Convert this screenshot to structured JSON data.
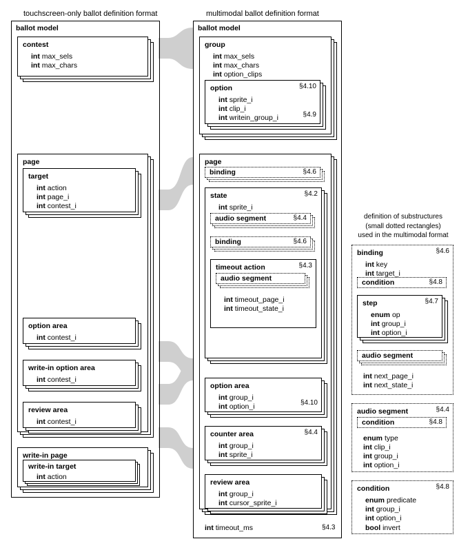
{
  "titles": {
    "left": "touchscreen-only ballot definition format",
    "mid": "multimodal ballot definition format",
    "sidenote1": "definition of substructures",
    "sidenote2": "(small dotted rectangles)",
    "sidenote3": "used in the multimodal format"
  },
  "labels": {
    "ballot_model": "ballot model",
    "contest": "contest",
    "group": "group",
    "option": "option",
    "page": "page",
    "target": "target",
    "binding": "binding",
    "state": "state",
    "audio_segment": "audio segment",
    "timeout_action": "timeout action",
    "option_area": "option area",
    "write_in_option_area": "write-in option area",
    "review_area": "review area",
    "counter_area": "counter area",
    "write_in_page": "write-in page",
    "write_in_target": "write-in target",
    "condition": "condition",
    "step": "step"
  },
  "types": {
    "int": "int",
    "enum": "enum",
    "bool": "bool"
  },
  "fields": {
    "max_sels": "max_sels",
    "max_chars": "max_chars",
    "option_clips": "option_clips",
    "sprite_i": "sprite_i",
    "clip_i": "clip_i",
    "writein_group_i": "writein_group_i",
    "action": "action",
    "page_i": "page_i",
    "contest_i": "contest_i",
    "group_i": "group_i",
    "option_i": "option_i",
    "cursor_sprite_i": "cursor_sprite_i",
    "timeout_page_i": "timeout_page_i",
    "timeout_state_i": "timeout_state_i",
    "timeout_ms": "timeout_ms",
    "key": "key",
    "target_i": "target_i",
    "op": "op",
    "next_page_i": "next_page_i",
    "next_state_i": "next_state_i",
    "type": "type",
    "predicate": "predicate",
    "invert": "invert"
  },
  "refs": {
    "s4_2": "§4.2",
    "s4_3": "§4.3",
    "s4_4": "§4.4",
    "s4_6": "§4.6",
    "s4_7": "§4.7",
    "s4_8": "§4.8",
    "s4_9": "§4.9",
    "s4_10": "§4.10"
  }
}
